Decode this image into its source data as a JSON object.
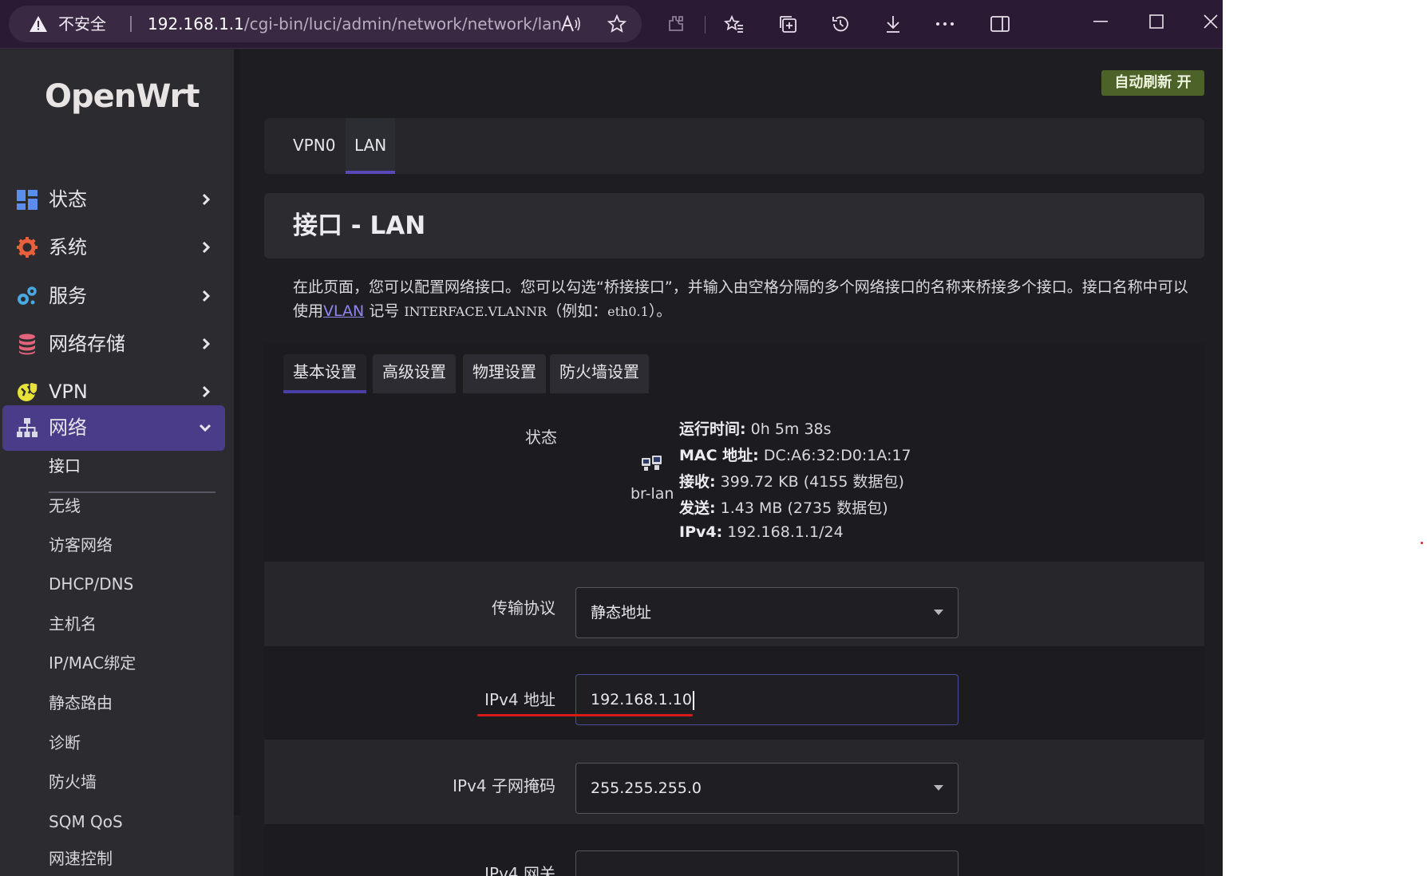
{
  "browser": {
    "security_label": "不安全",
    "url_host": "192.168.1.1",
    "url_path": "/cgi-bin/luci/admin/network/network/lan"
  },
  "sidebar": {
    "logo": "OpenWrt",
    "menu": [
      {
        "label": "状态",
        "icon": "dashboard-icon",
        "color": "#5b8def"
      },
      {
        "label": "系统",
        "icon": "gear-icon",
        "color": "#e8613c"
      },
      {
        "label": "服务",
        "icon": "cogs-icon",
        "color": "#4aa8e0"
      },
      {
        "label": "网络存储",
        "icon": "database-icon",
        "color": "#e3647a"
      },
      {
        "label": "VPN",
        "icon": "vpn-shield-icon",
        "color": "#e6e23a"
      },
      {
        "label": "网络",
        "icon": "sitemap-icon",
        "color": "#d8d8e6"
      }
    ],
    "submenu": [
      "接口",
      "无线",
      "访客网络",
      "DHCP/DNS",
      "主机名",
      "IP/MAC绑定",
      "静态路由",
      "诊断",
      "防火墙",
      "SQM QoS",
      "网速控制"
    ]
  },
  "main": {
    "autorefresh": "自动刷新 开",
    "interface_tabs": [
      "VPN0",
      "LAN"
    ],
    "title": "接口 - LAN",
    "description": {
      "part1": "在此页面，您可以配置网络接口。您可以勾选“桥接接口”，并输入由空格分隔的多个网络接口的名称来桥接多个接口。接口名称中可以使用",
      "link": "VLAN",
      "part2": "记号",
      "mono1": "INTERFACE.VLANNR",
      "part3": "（例如：",
      "mono2": "eth0.1",
      "part4": "）。"
    },
    "config_tabs": [
      "基本设置",
      "高级设置",
      "物理设置",
      "防火墙设置"
    ],
    "status": {
      "label": "状态",
      "device": "br-lan",
      "uptime_key": "运行时间:",
      "uptime_val": "0h 5m 38s",
      "mac_key": "MAC 地址:",
      "mac_val": "DC:A6:32:D0:1A:17",
      "rx_key": "接收:",
      "rx_val": "399.72 KB (4155 数据包)",
      "tx_key": "发送:",
      "tx_val": "1.43 MB (2735 数据包)",
      "ipv4_key": "IPv4:",
      "ipv4_val": "192.168.1.1/24"
    },
    "fields": {
      "protocol_label": "传输协议",
      "protocol_value": "静态地址",
      "ipv4_label": "IPv4 地址",
      "ipv4_value": "192.168.1.10",
      "netmask_label": "IPv4 子网掩码",
      "netmask_value": "255.255.255.0",
      "gateway_label": "IPv4 网关",
      "gateway_value": ""
    }
  },
  "colors": {
    "accent": "#4b3c8a",
    "autorefresh_bg": "#4d6228",
    "annotation_red": "#d81a1a"
  }
}
